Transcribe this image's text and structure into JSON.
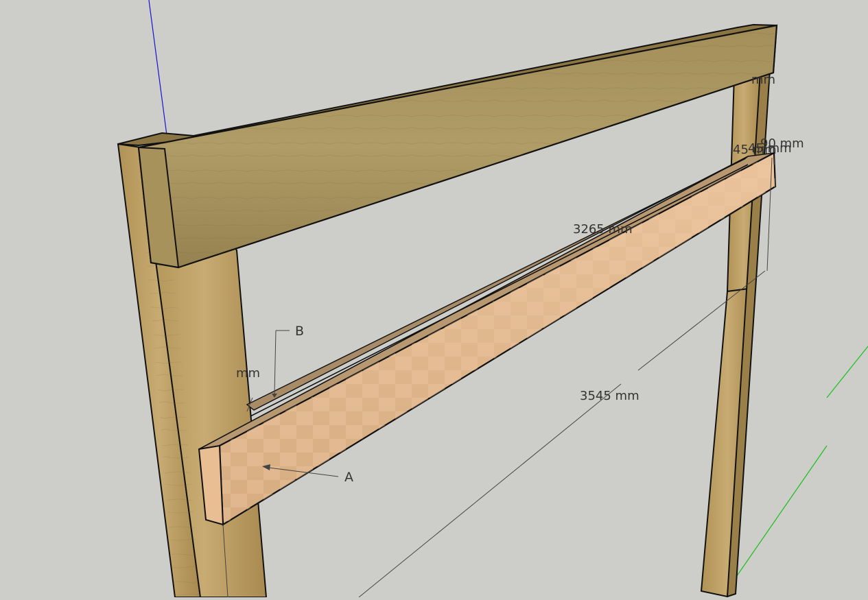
{
  "scene": {
    "background": "#cdcdc9",
    "axes": {
      "blue_axis_color": "#1414d2",
      "green_axis_color": "#18c018"
    },
    "materials": {
      "post_front_color": "#bda066",
      "post_side_color": "#9a8048",
      "beam_front_color": "#9e8a54",
      "beam_top_color": "#8a7543",
      "rail_front_color": "#e2b990",
      "rail_top_color": "#c9a47a",
      "edge_color": "#111111"
    },
    "dimensions": {
      "top_right_mm": "mm",
      "stack_a": "90 mm",
      "stack_b": "45 mm",
      "stack_c": "45 mm",
      "rail_length": "3265 mm",
      "diagonal_length": "3545 mm",
      "left_mm": "mm"
    },
    "callouts": {
      "a": "A",
      "b": "B"
    }
  }
}
